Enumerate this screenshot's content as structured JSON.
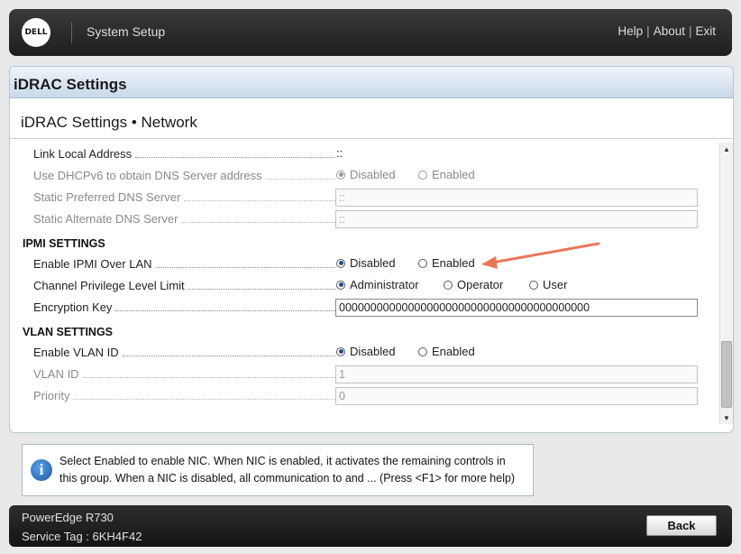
{
  "header": {
    "logo_text": "DELL",
    "title": "System Setup",
    "links": {
      "help": "Help",
      "about": "About",
      "exit": "Exit",
      "separator": "|"
    }
  },
  "panel": {
    "title": "iDRAC Settings",
    "page_title": "iDRAC Settings • Network"
  },
  "rows": {
    "link_local": {
      "label": "Link Local Address",
      "value": "::"
    },
    "dhcpv6": {
      "label": "Use DHCPv6 to obtain DNS Server address",
      "options": [
        "Disabled",
        "Enabled"
      ],
      "selected": "Disabled",
      "disabled": true
    },
    "pref_dns": {
      "label": "Static Preferred DNS Server",
      "value": "::",
      "disabled": true
    },
    "alt_dns": {
      "label": "Static Alternate DNS Server",
      "value": "::",
      "disabled": true
    }
  },
  "ipmi": {
    "heading": "IPMI SETTINGS",
    "enable_label": "Enable IPMI Over LAN",
    "enable_options": [
      "Disabled",
      "Enabled"
    ],
    "enable_selected": "Disabled",
    "privilege_label": "Channel Privilege Level Limit",
    "privilege_options": [
      "Administrator",
      "Operator",
      "User"
    ],
    "privilege_selected": "Administrator",
    "key_label": "Encryption Key",
    "key_value": "0000000000000000000000000000000000000000"
  },
  "vlan": {
    "heading": "VLAN SETTINGS",
    "enable_label": "Enable VLAN ID",
    "enable_options": [
      "Disabled",
      "Enabled"
    ],
    "enable_selected": "Disabled",
    "id_label": "VLAN ID",
    "id_value": "1",
    "priority_label": "Priority",
    "priority_value": "0"
  },
  "help": {
    "line1": "Select Enabled to enable NIC. When NIC is enabled, it activates the remaining controls in",
    "line2": "this group. When a NIC is disabled, all communication to and ... (Press <F1> for more help)"
  },
  "footer": {
    "model": "PowerEdge R730",
    "service_tag": "Service Tag : 6KH4F42",
    "back_label": "Back"
  },
  "colors": {
    "annotation_arrow": "#e8775a",
    "radio_selected": "#2a4d8a"
  },
  "scrollbar": {
    "position_fraction": 0.78
  }
}
